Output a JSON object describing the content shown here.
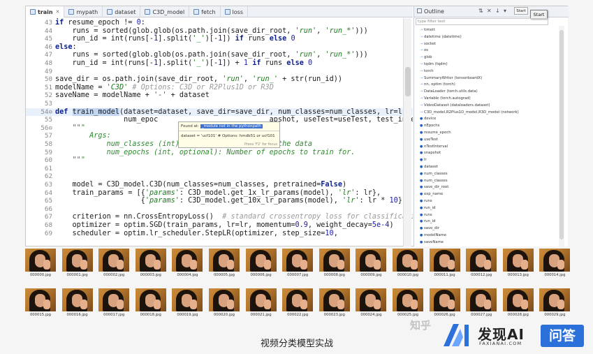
{
  "tabs": [
    {
      "label": "train",
      "active": true
    },
    {
      "label": "mypath",
      "active": false
    },
    {
      "label": "dataset",
      "active": false
    },
    {
      "label": "C3D_model",
      "active": false
    },
    {
      "label": "fetch",
      "active": false
    },
    {
      "label": "loss",
      "active": false
    }
  ],
  "editor": {
    "lines": [
      {
        "n": "43",
        "html": "<span class=\"kw\">if</span> resume_epoch != <span class=\"num\">0</span>:"
      },
      {
        "n": "44",
        "html": "    runs = sorted(glob.glob(os.path.join(save_dir_root, <span class=\"str\">'run'</span>, <span class=\"str\">'run_*'</span>)))"
      },
      {
        "n": "45",
        "html": "    run_id = int(runs[-<span class=\"num\">1</span>].split(<span class=\"str\">'_'</span>)[-<span class=\"num\">1</span>]) <span class=\"kw\">if</span> runs <span class=\"kw\">else</span> <span class=\"num\">0</span>"
      },
      {
        "n": "46",
        "html": "<span class=\"kw\">else</span>:"
      },
      {
        "n": "47",
        "html": "    runs = sorted(glob.glob(os.path.join(save_dir_root, <span class=\"str\">'run'</span>, <span class=\"str\">'run_*'</span>)))"
      },
      {
        "n": "48",
        "html": "    run_id = int(runs[-<span class=\"num\">1</span>].split(<span class=\"str\">'_'</span>)[-<span class=\"num\">1</span>]) + <span class=\"num\">1</span> <span class=\"kw\">if</span> runs <span class=\"kw\">else</span> <span class=\"num\">0</span>"
      },
      {
        "n": "49",
        "html": ""
      },
      {
        "n": "50",
        "html": "save_dir = os.path.join(save_dir_root, <span class=\"str\">'run'</span>, <span class=\"str\">'run_'</span> + str(run_id))"
      },
      {
        "n": "51",
        "html": "modelName = <span class=\"str\">'C3D'</span> <span class=\"cmt\"># Options: C3D or R2Plus1D or R3D</span>"
      },
      {
        "n": "52",
        "html": "saveName = modelName + <span class=\"str\">'-'</span> + dataset"
      },
      {
        "n": "53",
        "html": ""
      },
      {
        "n": "54⊖",
        "html": "<span class=\"kw\">def</span> <span class=\"sel\">train_model</span>(dataset=dataset, save_dir=save_dir, num_classes=num_classes, lr=lr,",
        "hl": true
      },
      {
        "n": "55",
        "html": "                num_epoc                          apshot, useTest=useTest, test_interv"
      },
      {
        "n": "56⊖",
        "html": "    <span class=\"doc\">\"\"\"</span>"
      },
      {
        "n": "57",
        "html": "        <span class=\"doc\">Args:</span>"
      },
      {
        "n": "58",
        "html": "            <span class=\"doc\">num_classes (int): Number of classes in the data</span>"
      },
      {
        "n": "59",
        "html": "            <span class=\"doc\">num_epochs (int, optional): Number of epochs to train for.</span>"
      },
      {
        "n": "60",
        "html": "    <span class=\"doc\">\"\"\"</span>"
      },
      {
        "n": "61",
        "html": ""
      },
      {
        "n": "62",
        "html": ""
      },
      {
        "n": "63",
        "html": "    model = C3D_model.C3D(num_classes=num_classes, pretrained=<span class=\"kw\">False</span>)"
      },
      {
        "n": "64",
        "html": "    train_params = [{<span class=\"str\">'params'</span>: C3D_model.get_1x_lr_params(model), <span class=\"str\">'lr'</span>: lr},"
      },
      {
        "n": "65",
        "html": "                    {<span class=\"str\">'params'</span>: C3D_model.get_10x_lr_params(model), <span class=\"str\">'lr'</span>: lr * <span class=\"num\">10</span>}]"
      },
      {
        "n": "66",
        "html": ""
      },
      {
        "n": "67",
        "html": "    criterion = nn.CrossEntropyLoss()  <span class=\"cmt\"># standard crossentropy loss for classificatio</span>"
      },
      {
        "n": "68",
        "html": "    optimizer = optim.SGD(train_params, lr=lr, momentum=<span class=\"num\">0.9</span>, weight_decay=<span class=\"num\">5e-4</span>)"
      },
      {
        "n": "69",
        "html": "    scheduler = optim.lr_scheduler.StepLR(optimizer, step_size=<span class=\"num\">10</span>,"
      }
    ]
  },
  "tooltip": {
    "found_prefix": "Found at:",
    "found_module": "_module not in the pythonpath",
    "definition": "dataset = 'ucf101' # Options: hmdb51 or ucf101",
    "focus_hint": "Press 'F2' for focus"
  },
  "outline": {
    "title": "Outline",
    "filter_placeholder": "type filter text",
    "start_button": "Start",
    "start_tooltip": "Start",
    "items": [
      {
        "label": "timeit",
        "kind": "import"
      },
      {
        "label": "datetime (datetime)",
        "kind": "import"
      },
      {
        "label": "socket",
        "kind": "import"
      },
      {
        "label": "os",
        "kind": "import"
      },
      {
        "label": "glob",
        "kind": "import"
      },
      {
        "label": "tqdm (tqdm)",
        "kind": "import"
      },
      {
        "label": "torch",
        "kind": "import"
      },
      {
        "label": "SummaryWriter (tensorboardX)",
        "kind": "import"
      },
      {
        "label": "nn, optim (torch)",
        "kind": "import"
      },
      {
        "label": "DataLoader (torch.utils.data)",
        "kind": "import"
      },
      {
        "label": "Variable (torch.autograd)",
        "kind": "import"
      },
      {
        "label": "VideoDataset (dataloaders.dataset)",
        "kind": "import"
      },
      {
        "label": "C3D_model,R2Plus1D_model,R3D_model (network)",
        "kind": "import"
      },
      {
        "label": "device",
        "kind": "var"
      },
      {
        "label": "nEpochs",
        "kind": "var"
      },
      {
        "label": "resume_epoch",
        "kind": "var"
      },
      {
        "label": "useTest",
        "kind": "var"
      },
      {
        "label": "nTestInterval",
        "kind": "var"
      },
      {
        "label": "snapshot",
        "kind": "var"
      },
      {
        "label": "lr",
        "kind": "var"
      },
      {
        "label": "dataset",
        "kind": "var"
      },
      {
        "label": "num_classes",
        "kind": "var"
      },
      {
        "label": "num_classes",
        "kind": "var"
      },
      {
        "label": "save_dir_root",
        "kind": "var"
      },
      {
        "label": "exp_name",
        "kind": "var"
      },
      {
        "label": "runs",
        "kind": "var"
      },
      {
        "label": "run_id",
        "kind": "var"
      },
      {
        "label": "runs",
        "kind": "var"
      },
      {
        "label": "run_id",
        "kind": "var"
      },
      {
        "label": "save_dir",
        "kind": "var"
      },
      {
        "label": "modelName",
        "kind": "var"
      },
      {
        "label": "saveName",
        "kind": "var"
      }
    ]
  },
  "thumbnails": [
    "000000.jpg",
    "000001.jpg",
    "000002.jpg",
    "000003.jpg",
    "000004.jpg",
    "000005.jpg",
    "000006.jpg",
    "000007.jpg",
    "000008.jpg",
    "000009.jpg",
    "000010.jpg",
    "000011.jpg",
    "000012.jpg",
    "000013.jpg",
    "000014.jpg",
    "000015.jpg",
    "000016.jpg",
    "000017.jpg",
    "000018.jpg",
    "000019.jpg",
    "000020.jpg",
    "000021.jpg",
    "000022.jpg",
    "000023.jpg",
    "000024.jpg",
    "000025.jpg",
    "000026.jpg",
    "000027.jpg",
    "000028.jpg",
    "000029.jpg"
  ],
  "caption": "视频分类模型实战",
  "watermark": "知乎",
  "logo": {
    "name": "发现AI",
    "sub": "FAXIANAI.COM",
    "qa": "问答",
    "accent": "#2b71d9"
  },
  "icons": {
    "tab": "python-file-icon",
    "outline": "outline-icon",
    "import": "import-icon",
    "var": "variable-icon"
  }
}
